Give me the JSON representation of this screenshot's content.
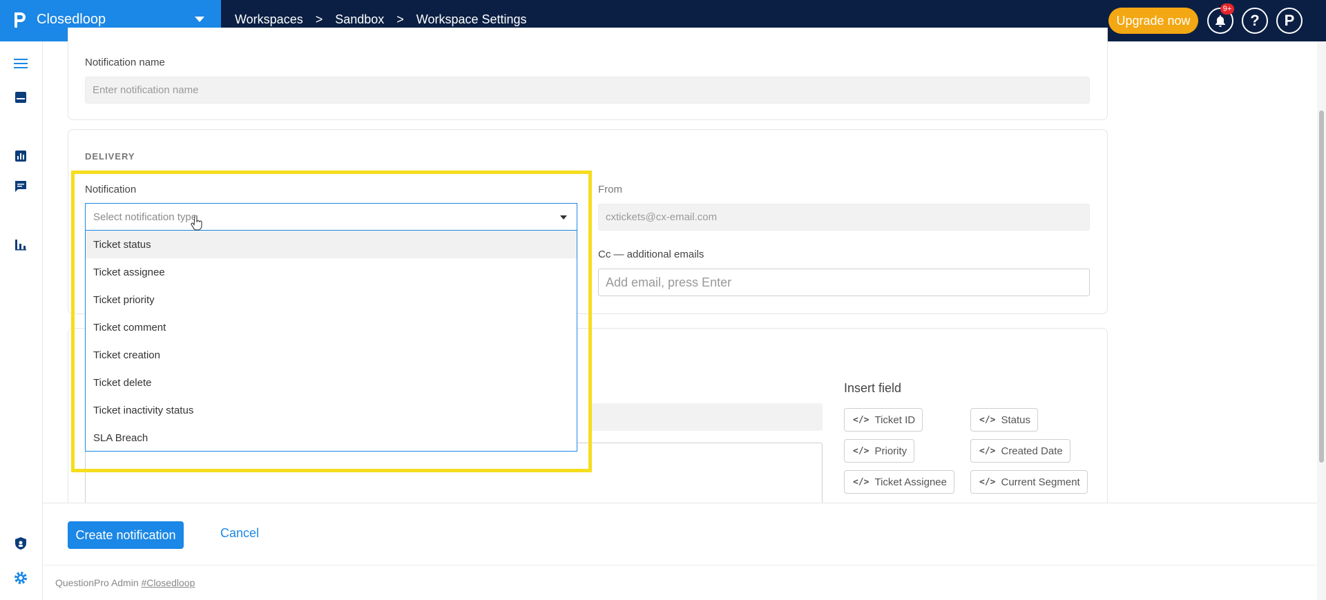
{
  "app": {
    "name": "Closedloop"
  },
  "breadcrumbs": [
    "Workspaces",
    "Sandbox",
    "Workspace Settings"
  ],
  "breadcrumb_sep": ">",
  "header": {
    "upgrade_label": "Upgrade now",
    "notification_badge": "9+",
    "help_label": "?",
    "profile_label": "P"
  },
  "sidebar": {
    "icons": [
      "menu-icon",
      "inbox-icon",
      "report-icon",
      "chat-icon",
      "bar-chart-icon",
      "shield-icon",
      "gear-icon"
    ]
  },
  "notification_name": {
    "label": "Notification name",
    "placeholder": "Enter notification name"
  },
  "delivery": {
    "title": "DELIVERY",
    "notification_label": "Notification",
    "select_placeholder": "Select notification type",
    "options": [
      "Ticket status",
      "Ticket assignee",
      "Ticket priority",
      "Ticket comment",
      "Ticket creation",
      "Ticket delete",
      "Ticket inactivity status",
      "SLA Breach"
    ],
    "from_label": "From",
    "from_value": "cxtickets@cx-email.com",
    "cc_label": "Cc — additional emails",
    "cc_placeholder": "Add email, press Enter"
  },
  "insert_field": {
    "title": "Insert field",
    "code_glyph": "</>",
    "chips": [
      "Ticket ID",
      "Status",
      "Priority",
      "Created Date",
      "Ticket Assignee",
      "Current Segment"
    ]
  },
  "actions": {
    "create_label": "Create notification",
    "cancel_label": "Cancel"
  },
  "footer": {
    "text": "QuestionPro Admin",
    "link": "#Closedloop"
  },
  "colors": {
    "brand_blue": "#1b87e6",
    "topbar_navy": "#0b1f44",
    "upgrade_orange": "#f3a712",
    "highlight_yellow": "#f6dd1d"
  }
}
